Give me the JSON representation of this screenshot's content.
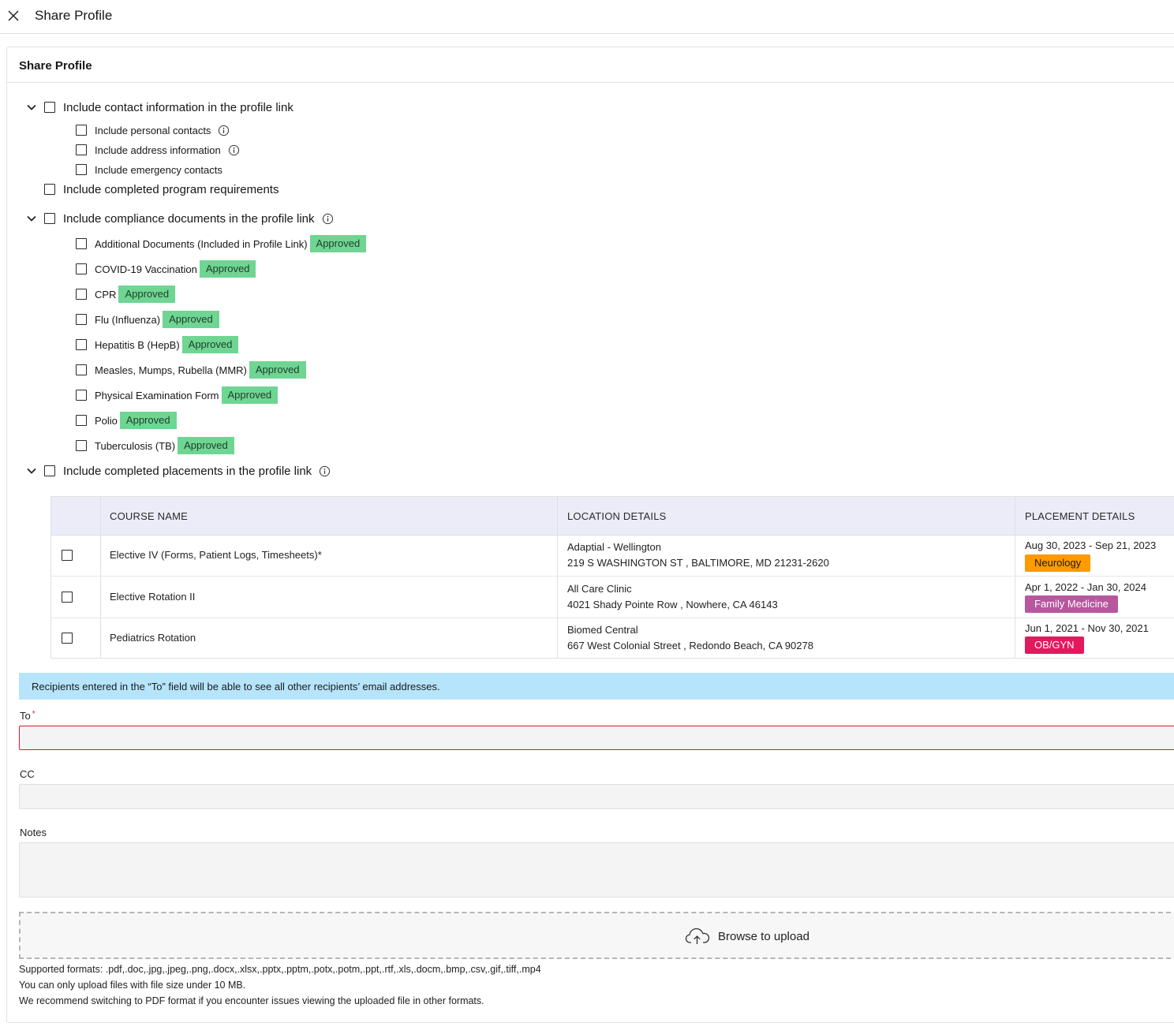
{
  "header": {
    "title": "Share Profile"
  },
  "panel": {
    "title": "Share Profile"
  },
  "options": {
    "contact": "Include contact information in the profile link",
    "contact_children": [
      "Include personal contacts",
      "Include address information",
      "Include emergency contacts"
    ],
    "program": "Include completed program requirements",
    "compliance": "Include compliance documents in the profile link",
    "documents": [
      {
        "name": "Additional Documents (Included in Profile Link)",
        "status": "Approved"
      },
      {
        "name": "COVID-19 Vaccination",
        "status": "Approved"
      },
      {
        "name": "CPR",
        "status": "Approved"
      },
      {
        "name": "Flu (Influenza)",
        "status": "Approved"
      },
      {
        "name": "Hepatitis B (HepB)",
        "status": "Approved"
      },
      {
        "name": "Measles, Mumps, Rubella (MMR)",
        "status": "Approved"
      },
      {
        "name": "Physical Examination Form",
        "status": "Approved"
      },
      {
        "name": "Polio",
        "status": "Approved"
      },
      {
        "name": "Tuberculosis (TB)",
        "status": "Approved"
      }
    ],
    "placements": "Include completed placements in the profile link"
  },
  "table": {
    "headers": [
      "COURSE NAME",
      "LOCATION DETAILS",
      "PLACEMENT DETAILS"
    ],
    "rows": [
      {
        "course": "Elective IV (Forms, Patient Logs, Timesheets)*",
        "location_name": "Adaptial - Wellington",
        "address": "219 S WASHINGTON ST , BALTIMORE, MD 21231-2620",
        "dates": "Aug 30, 2023 - Sep 21, 2023",
        "tag": "Neurology",
        "tag_color": "#ff9a00"
      },
      {
        "course": "Elective Rotation II",
        "location_name": "All Care Clinic",
        "address": "4021 Shady Pointe Row , Nowhere, CA 46143",
        "dates": "Apr 1, 2022 - Jan 30, 2024",
        "tag": "Family Medicine",
        "tag_color": "#b7579d"
      },
      {
        "course": "Pediatrics Rotation",
        "location_name": "Biomed Central",
        "address": "667 West Colonial Street , Redondo Beach, CA 90278",
        "dates": "Jun 1, 2021 - Nov 30, 2021",
        "tag": "OB/GYN",
        "tag_color": "#e5185d"
      }
    ]
  },
  "notice": "Recipients entered in the “To” field will be able to see all other recipients’ email addresses.",
  "form": {
    "to_label": "To",
    "to_required": "*",
    "to_value": "",
    "cc_label": "CC",
    "cc_value": "",
    "notes_label": "Notes",
    "notes_value": ""
  },
  "upload": {
    "label": "Browse to upload",
    "icon": "cloud-upload-icon",
    "hints": [
      "Supported formats: .pdf,.doc,.jpg,.jpeg,.png,.docx,.xlsx,.pptx,.pptm,.potx,.potm,.ppt,.rtf,.xls,.docm,.bmp,.csv,.gif,.tiff,.mp4",
      "You can only upload files with file size under 10 MB.",
      "We recommend switching to PDF format if you encounter issues viewing the uploaded file in other formats."
    ]
  }
}
